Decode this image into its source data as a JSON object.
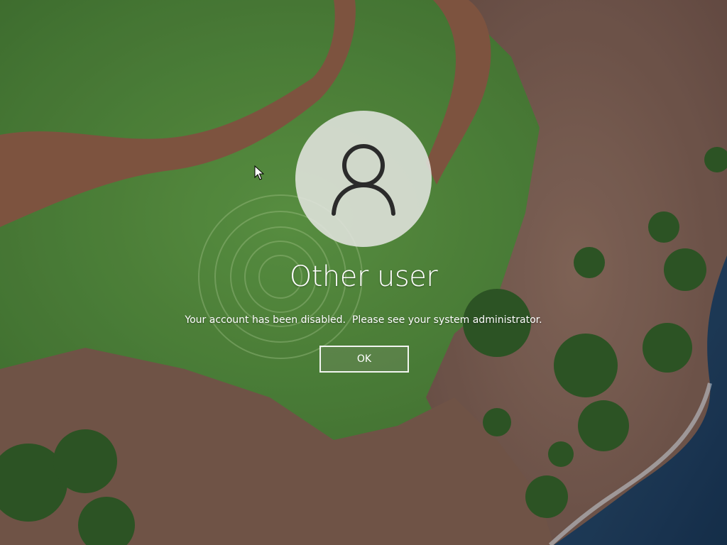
{
  "login": {
    "user_name": "Other user",
    "message": "Your account has been disabled.  Please see your system administrator.",
    "ok_label": "OK"
  },
  "icons": {
    "avatar": "user-silhouette-icon",
    "cursor": "mouse-pointer-icon"
  },
  "colors": {
    "text": "#ffffff",
    "avatar_bg": "#e1e4de",
    "button_border": "#ffffff"
  }
}
